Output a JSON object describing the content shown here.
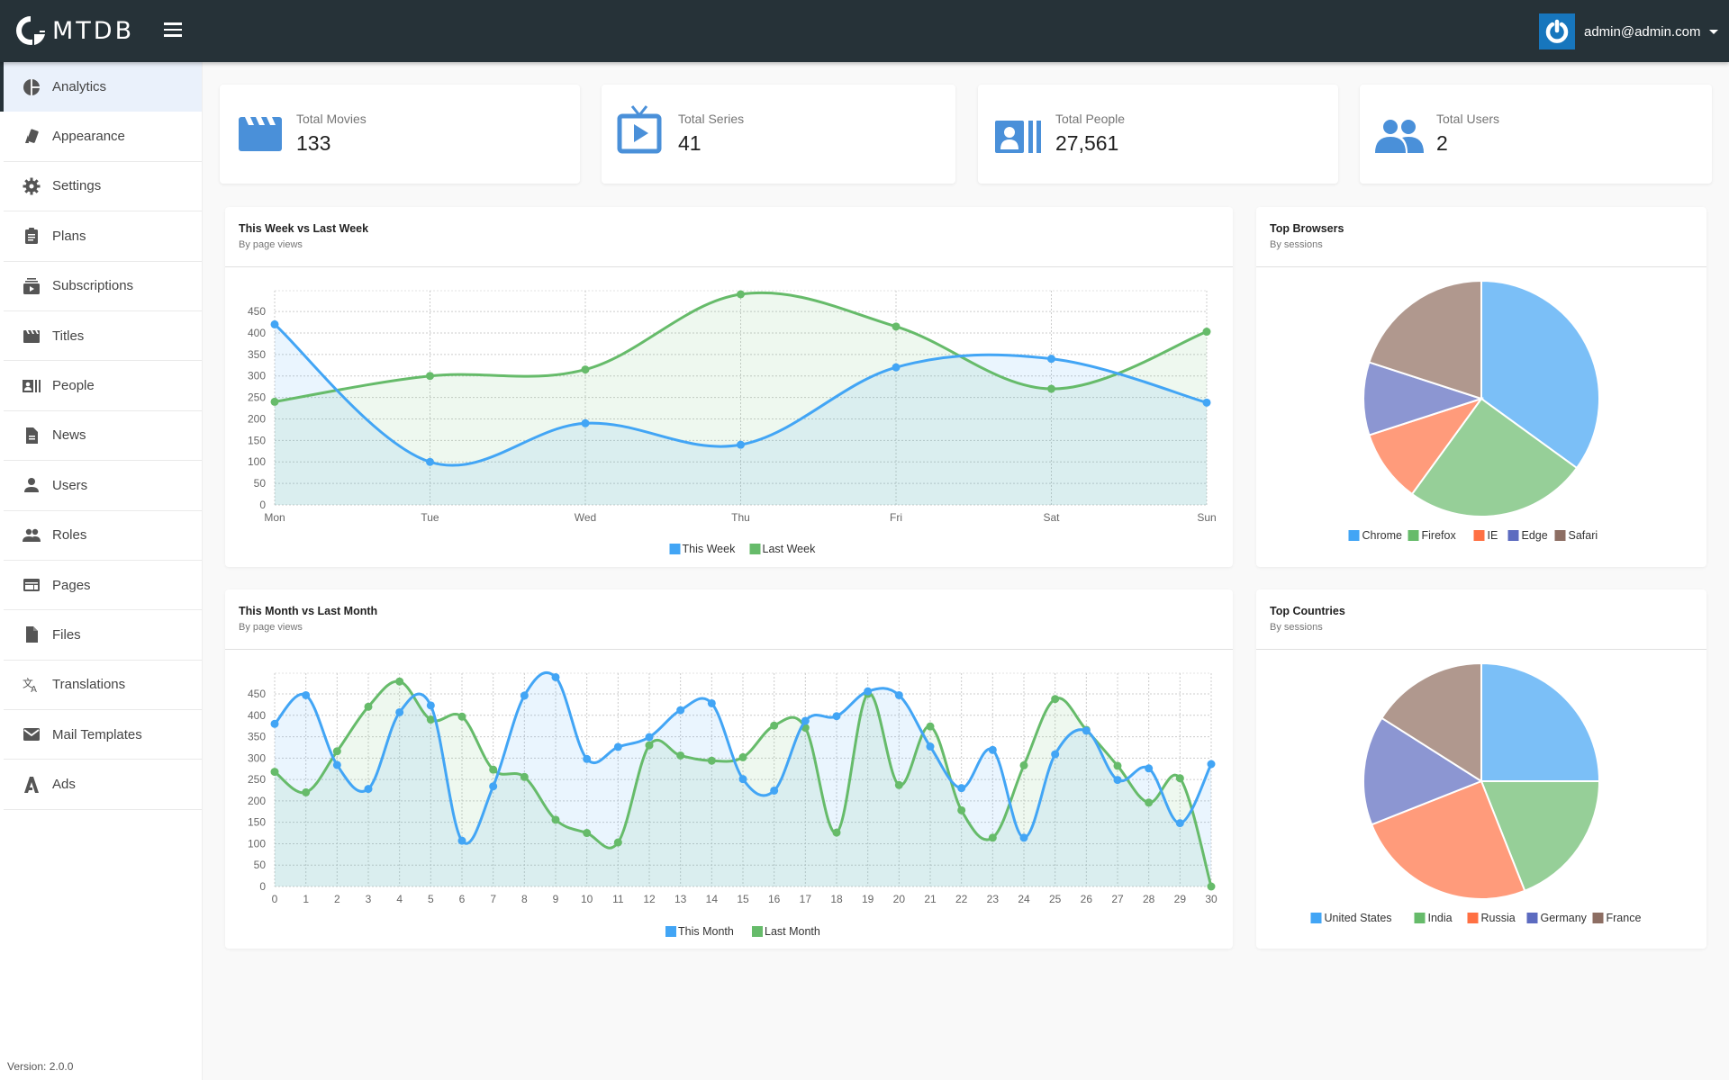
{
  "header": {
    "brand": "MTDB",
    "user_email": "admin@admin.com"
  },
  "sidebar": {
    "items": [
      {
        "label": "Analytics",
        "icon": "pie-chart-icon",
        "active": true
      },
      {
        "label": "Appearance",
        "icon": "palette-icon"
      },
      {
        "label": "Settings",
        "icon": "gear-icon"
      },
      {
        "label": "Plans",
        "icon": "clipboard-icon"
      },
      {
        "label": "Subscriptions",
        "icon": "subscriptions-icon"
      },
      {
        "label": "Titles",
        "icon": "clapperboard-icon"
      },
      {
        "label": "People",
        "icon": "contact-card-icon"
      },
      {
        "label": "News",
        "icon": "document-icon"
      },
      {
        "label": "Users",
        "icon": "person-icon"
      },
      {
        "label": "Roles",
        "icon": "people-icon"
      },
      {
        "label": "Pages",
        "icon": "web-page-icon"
      },
      {
        "label": "Files",
        "icon": "file-icon"
      },
      {
        "label": "Translations",
        "icon": "translate-icon"
      },
      {
        "label": "Mail Templates",
        "icon": "mail-icon"
      },
      {
        "label": "Ads",
        "icon": "ads-icon"
      }
    ],
    "version": "Version: 2.0.0"
  },
  "stats": [
    {
      "label": "Total Movies",
      "value": "133",
      "icon": "clapperboard-icon"
    },
    {
      "label": "Total Series",
      "value": "41",
      "icon": "tv-play-icon"
    },
    {
      "label": "Total People",
      "value": "27,561",
      "icon": "contact-card-icon"
    },
    {
      "label": "Total Users",
      "value": "2",
      "icon": "people-icon"
    }
  ],
  "colors": {
    "blue": "#42a5f5",
    "green": "#66bb6a",
    "orange": "#ff7043",
    "indigo": "#5c6bc0",
    "brown": "#8d6e63",
    "stat_icon": "#4a90d9"
  },
  "chart_data": [
    {
      "id": "weekly",
      "type": "line",
      "title": "This Week vs Last Week",
      "subtitle": "By page views",
      "categories": [
        "Mon",
        "Tue",
        "Wed",
        "Thu",
        "Fri",
        "Sat",
        "Sun"
      ],
      "yticks": [
        0,
        50,
        100,
        150,
        200,
        250,
        300,
        350,
        400,
        450
      ],
      "ylim": [
        0,
        490
      ],
      "grid": true,
      "legend": "bottom",
      "series": [
        {
          "name": "This Week",
          "color": "#42a5f5",
          "values": [
            420,
            100,
            190,
            140,
            320,
            340,
            238
          ]
        },
        {
          "name": "Last Week",
          "color": "#66bb6a",
          "values": [
            240,
            300,
            315,
            490,
            415,
            270,
            403
          ]
        }
      ]
    },
    {
      "id": "monthly",
      "type": "line",
      "title": "This Month vs Last Month",
      "subtitle": "By page views",
      "categories": [
        "0",
        "1",
        "2",
        "3",
        "4",
        "5",
        "6",
        "7",
        "8",
        "9",
        "10",
        "11",
        "12",
        "13",
        "14",
        "15",
        "16",
        "17",
        "18",
        "19",
        "20",
        "21",
        "22",
        "23",
        "24",
        "25",
        "26",
        "27",
        "28",
        "29",
        "30"
      ],
      "yticks": [
        0,
        50,
        100,
        150,
        200,
        250,
        300,
        350,
        400,
        450
      ],
      "ylim": [
        0,
        490
      ],
      "grid": true,
      "legend": "bottom",
      "series": [
        {
          "name": "This Month",
          "color": "#42a5f5",
          "values": [
            380,
            447,
            284,
            228,
            407,
            423,
            107,
            234,
            446,
            489,
            298,
            326,
            349,
            412,
            428,
            251,
            224,
            387,
            398,
            456,
            447,
            327,
            230,
            319,
            114,
            309,
            364,
            249,
            276,
            148,
            286
          ]
        },
        {
          "name": "Last Month",
          "color": "#66bb6a",
          "values": [
            268,
            220,
            316,
            420,
            479,
            390,
            397,
            273,
            256,
            156,
            125,
            103,
            330,
            306,
            294,
            302,
            376,
            371,
            126,
            450,
            237,
            374,
            178,
            114,
            283,
            438,
            366,
            282,
            196,
            253,
            0
          ]
        }
      ]
    },
    {
      "id": "browsers",
      "type": "pie",
      "title": "Top Browsers",
      "subtitle": "By sessions",
      "legend": "bottom",
      "labels": [
        "Chrome",
        "Firefox",
        "IE",
        "Edge",
        "Safari"
      ],
      "values": [
        35,
        25,
        10,
        10,
        20
      ],
      "colors": [
        "#42a5f5",
        "#66bb6a",
        "#ff7043",
        "#5c6bc0",
        "#8d6e63"
      ]
    },
    {
      "id": "countries",
      "type": "pie",
      "title": "Top Countries",
      "subtitle": "By sessions",
      "legend": "bottom",
      "labels": [
        "United States",
        "India",
        "Russia",
        "Germany",
        "France"
      ],
      "values": [
        25,
        19,
        25,
        15,
        16
      ],
      "colors": [
        "#42a5f5",
        "#66bb6a",
        "#ff7043",
        "#5c6bc0",
        "#8d6e63"
      ]
    }
  ]
}
